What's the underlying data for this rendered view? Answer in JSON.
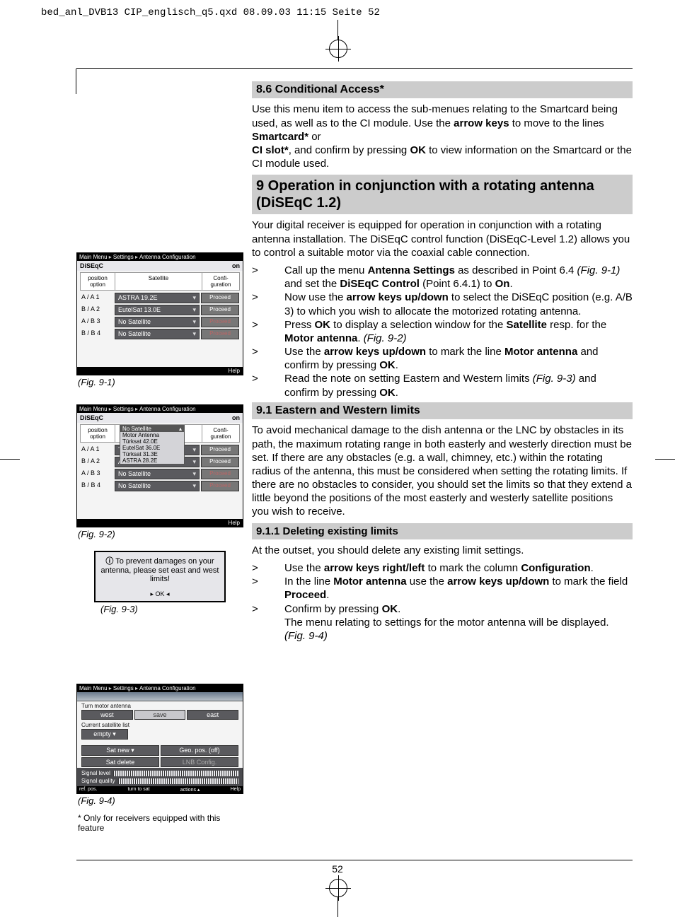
{
  "header_line": "bed_anl_DVB13 CIP_englisch_q5.qxd  08.09.03  11:15  Seite 52",
  "page_number": "52",
  "section_86": {
    "title": "8.6 Conditional Access*",
    "para": "Use this menu item to access the sub-menues relating to the Smartcard being used, as well as to the CI module. Use the ",
    "bold_arrow": "arrow keys",
    "mid1": " to move to the lines ",
    "bold_sc": "Smartcard*",
    "mid2": " or ",
    "bold_ci": "CI slot*",
    "mid3": ", and confirm by pressing ",
    "bold_ok": "OK",
    "end": " to view information on the Smartcard or the CI module used."
  },
  "section_9": {
    "title": "9 Operation in conjunction with a rotating antenna (DiSEqC 1.2)",
    "para": "Your digital receiver is equipped for operation in conjunction with a rotating antenna installation. The  DiSEqC control function (DiSEqC-Level 1.2) allows you to control a suitable motor via the coaxial cable connection.",
    "steps": [
      {
        "t1": "Call up the menu ",
        "b1": "Antenna Settings",
        "t2": " as described in Point 6.4 ",
        "i1": "(Fig. 9-1)",
        "t3": " and set the  ",
        "b2": "DiSEqC Control",
        "t4": " (Point 6.4.1) to ",
        "b3": "On",
        "t5": "."
      },
      {
        "t1": "Now use the ",
        "b1": "arrow keys up/down",
        "t2": " to select the DiSEqC position (e.g. A/B 3) to which you wish to allocate the motorized  rotating antenna."
      },
      {
        "t1": "Press ",
        "b1": "OK",
        "t2": " to display a selection window for the ",
        "b2": "Satellite",
        "t3": " resp. for the ",
        "b3": "Motor antenna",
        "t4": ". ",
        "i1": "(Fig. 9-2)"
      },
      {
        "t1": "Use the ",
        "b1": "arrow keys up/down",
        "t2": " to mark the line ",
        "b2": "Motor antenna",
        "t3": " and confirm by pressing ",
        "b3": "OK",
        "t4": "."
      },
      {
        "t1": "Read the note on setting Eastern and Western limits ",
        "i1": "(Fig. 9-3)",
        "t2": " and confirm by pressing ",
        "b1": "OK",
        "t3": "."
      }
    ]
  },
  "section_91": {
    "title": "9.1 Eastern and Western limits",
    "para": "To avoid mechanical damage to the dish antenna or the LNC by obstacles in its path, the maximum rotating range in both easterly and westerly direction must be set. If there are any obstacles (e.g. a wall, chimney, etc.) within the rotating radius of the antenna, this must be considered when setting the rotating limits. If there are no obstacles to consider, you should set the limits so that they extend a little beyond the positions of the most easterly and westerly satellite positions you wish to receive."
  },
  "section_911": {
    "title": "9.1.1 Deleting existing limits",
    "para": "At the outset, you should delete any existing limit settings.",
    "steps": [
      {
        "t1": "Use the ",
        "b1": "arrow keys right/left",
        "t2": " to mark the column ",
        "b2": "Configuration",
        "t3": "."
      },
      {
        "t1": "In the line ",
        "b1": "Motor antenna",
        "t2": " use the ",
        "b2": "arrow keys up/down",
        "t3": " to mark the field ",
        "b3": "Proceed",
        "t4": "."
      },
      {
        "t1": "Confirm by pressing ",
        "b1": "OK",
        "t2": ".",
        "tail": "The menu relating to settings for the motor antenna will be displayed. ",
        "i1": "(Fig. 9-4)"
      }
    ]
  },
  "breadcrumb": [
    "Main Menu",
    "Settings",
    "Antenna Configuration"
  ],
  "fig91": {
    "caption": "(Fig. 9-1)",
    "diseqc_label": "DiSEqC",
    "diseqc_value": "on",
    "headers": {
      "c1": "position option",
      "c2": "Satellite",
      "c3": "Confi-guration"
    },
    "rows": [
      {
        "c1": "A / A   1",
        "c2": "ASTRA 19.2E",
        "c3": "Proceed",
        "off": false
      },
      {
        "c1": "B / A   2",
        "c2": "EutelSat 13.0E",
        "c3": "Proceed",
        "off": false
      },
      {
        "c1": "A / B   3",
        "c2": "No Satellite",
        "c3": "Proceed",
        "off": true
      },
      {
        "c1": "B / B   4",
        "c2": "No Satellite",
        "c3": "Proceed",
        "off": true
      }
    ],
    "help": "Help"
  },
  "fig92": {
    "caption": "(Fig. 9-2)",
    "diseqc_label": "DiSEqC",
    "diseqc_value": "on",
    "headers": {
      "c1": "position option",
      "c2": "",
      "c3": "Confi-guration"
    },
    "rows": [
      {
        "c1": "A / A   1",
        "c2": "Türksat 31.3E",
        "c3": "Proceed",
        "off": false
      },
      {
        "c1": "B / A   2",
        "c2": "ASTRA 28.2E",
        "c3": "Proceed",
        "off": false
      },
      {
        "c1": "A / B   3",
        "c2": "No Satellite",
        "c3": "Proceed",
        "off": true
      },
      {
        "c1": "B / B   4",
        "c2": "No Satellite",
        "c3": "Proceed",
        "off": true
      }
    ],
    "overlay": [
      "No Satellite",
      "Motor Antenna",
      "Türksat 42.0E",
      "EutelSat 36.0E",
      "Türksat 31.3E",
      "ASTRA 28.2E"
    ],
    "help": "Help"
  },
  "fig93": {
    "caption": "(Fig. 9-3)",
    "info_icon": "ⓘ",
    "text": "To prevent damages on your antenna, please set east and west limits!",
    "ok": "OK"
  },
  "fig94": {
    "caption": "(Fig. 9-4)",
    "turn_label": "Turn motor antenna",
    "west": "west",
    "save": "save",
    "east": "east",
    "cur_label": "Current satellite list",
    "empty": "empty",
    "satnew": "Sat new",
    "geopos": "Geo. pos. (off)",
    "satdel": "Sat delete",
    "lnb": "LNB Config.",
    "siglvl": "Signal level",
    "sigq": "Signal quality",
    "foot": [
      "ref. pos.",
      "turn to sat",
      "actions ▴",
      "Help"
    ]
  },
  "footnote": "* Only for receivers equipped with this feature"
}
